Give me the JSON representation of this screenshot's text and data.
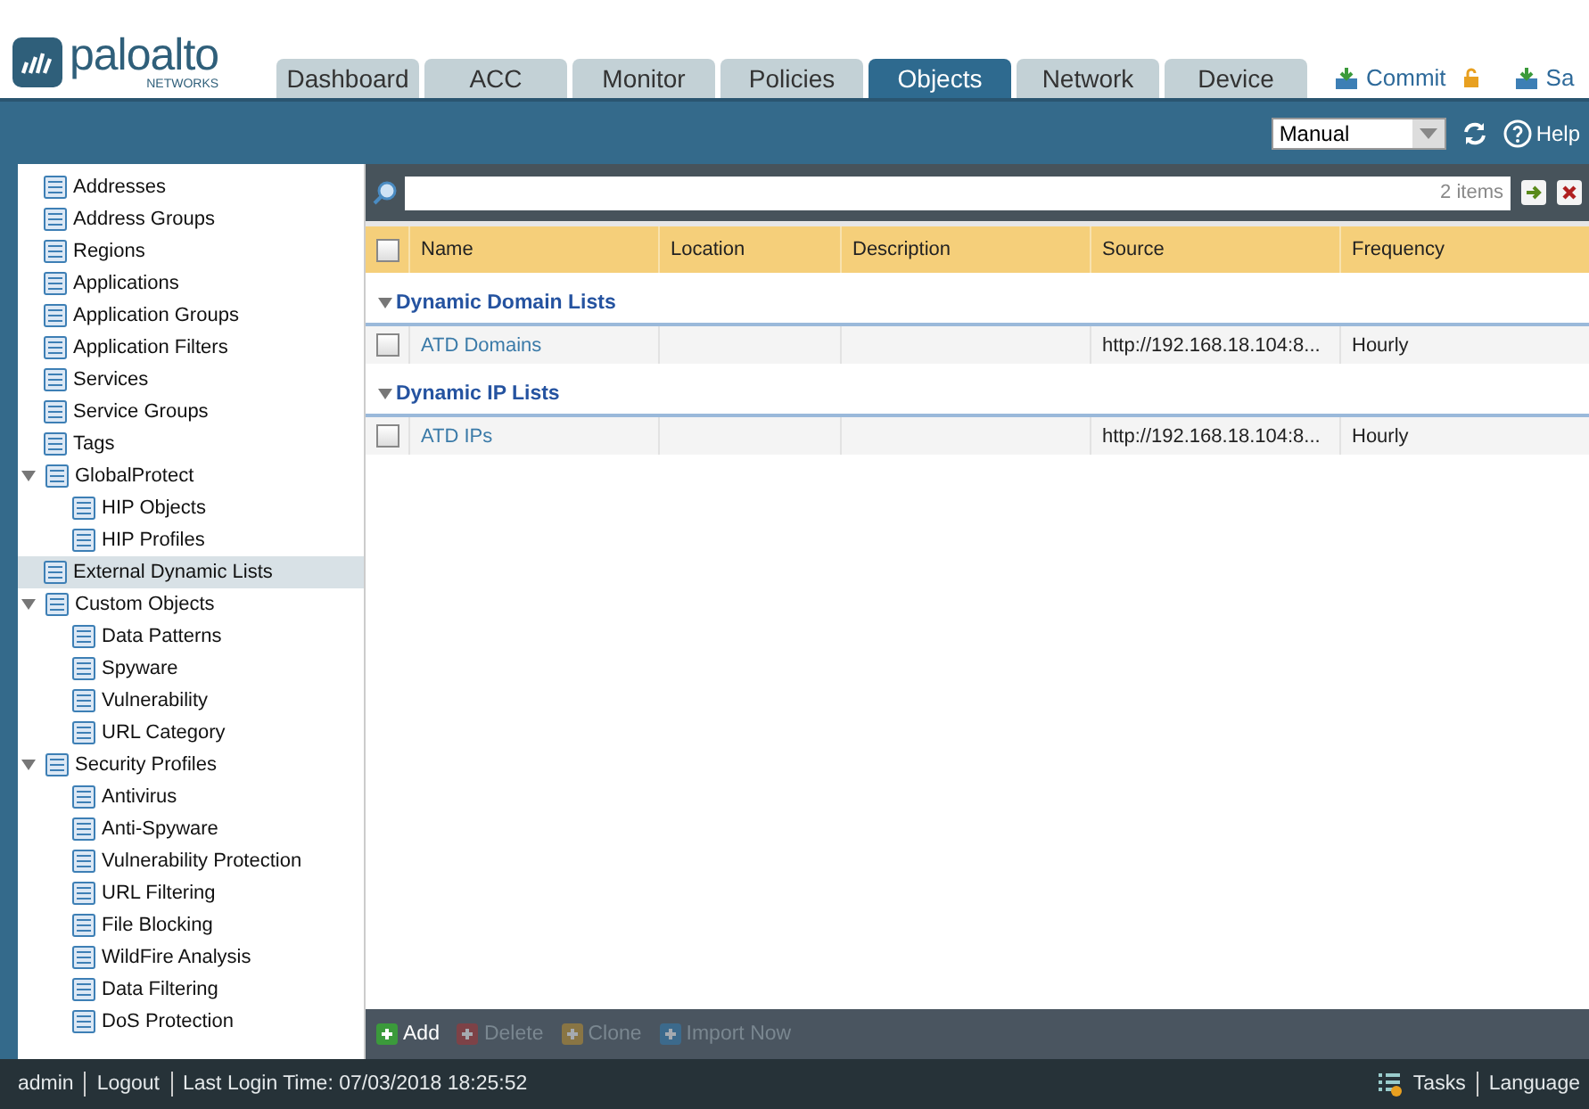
{
  "logo": {
    "name": "paloalto",
    "sub": "NETWORKS"
  },
  "tabs": [
    {
      "label": "Dashboard",
      "selected": false
    },
    {
      "label": "ACC",
      "selected": false
    },
    {
      "label": "Monitor",
      "selected": false
    },
    {
      "label": "Policies",
      "selected": false
    },
    {
      "label": "Objects",
      "selected": true
    },
    {
      "label": "Network",
      "selected": false
    },
    {
      "label": "Device",
      "selected": false
    }
  ],
  "header_actions": [
    {
      "label": "Commit"
    },
    {
      "label": "Sa"
    }
  ],
  "toolbar": {
    "mode": "Manual",
    "help": "Help"
  },
  "sidebar": {
    "items": [
      {
        "label": "Addresses",
        "selected": false
      },
      {
        "label": "Address Groups",
        "selected": false
      },
      {
        "label": "Regions",
        "selected": false
      },
      {
        "label": "Applications",
        "selected": false
      },
      {
        "label": "Application Groups",
        "selected": false
      },
      {
        "label": "Application Filters",
        "selected": false
      },
      {
        "label": "Services",
        "selected": false
      },
      {
        "label": "Service Groups",
        "selected": false
      },
      {
        "label": "Tags",
        "selected": false
      },
      {
        "label": "GlobalProtect",
        "selected": false,
        "expanded": true,
        "children": [
          {
            "label": "HIP Objects",
            "selected": false
          },
          {
            "label": "HIP Profiles",
            "selected": false
          }
        ]
      },
      {
        "label": "External Dynamic Lists",
        "selected": true
      },
      {
        "label": "Custom Objects",
        "selected": false,
        "expanded": true,
        "children": [
          {
            "label": "Data Patterns",
            "selected": false
          },
          {
            "label": "Spyware",
            "selected": false
          },
          {
            "label": "Vulnerability",
            "selected": false
          },
          {
            "label": "URL Category",
            "selected": false
          }
        ]
      },
      {
        "label": "Security Profiles",
        "selected": false,
        "expanded": true,
        "children": [
          {
            "label": "Antivirus",
            "selected": false
          },
          {
            "label": "Anti-Spyware",
            "selected": false
          },
          {
            "label": "Vulnerability Protection",
            "selected": false
          },
          {
            "label": "URL Filtering",
            "selected": false
          },
          {
            "label": "File Blocking",
            "selected": false
          },
          {
            "label": "WildFire Analysis",
            "selected": false
          },
          {
            "label": "Data Filtering",
            "selected": false
          },
          {
            "label": "DoS Protection",
            "selected": false
          }
        ]
      }
    ]
  },
  "search": {
    "count": "2 items"
  },
  "table": {
    "select_all": {
      "checked": false
    },
    "columns": [
      "Name",
      "Location",
      "Description",
      "Source",
      "Frequency"
    ],
    "groups": [
      {
        "title": "Dynamic Domain Lists",
        "expanded": true,
        "rows": [
          {
            "checked": false,
            "cells": [
              "ATD Domains",
              "",
              "",
              "http://192.168.18.104:8...",
              "Hourly"
            ]
          }
        ]
      },
      {
        "title": "Dynamic IP Lists",
        "expanded": true,
        "rows": [
          {
            "checked": false,
            "cells": [
              "ATD IPs",
              "",
              "",
              "http://192.168.18.104:8...",
              "Hourly"
            ]
          }
        ]
      }
    ]
  },
  "actions": [
    {
      "label": "Add",
      "kind": "add",
      "disabled": false
    },
    {
      "label": "Delete",
      "kind": "delete",
      "disabled": true
    },
    {
      "label": "Clone",
      "kind": "clone",
      "disabled": true
    },
    {
      "label": "Import Now",
      "kind": "import",
      "disabled": true
    }
  ],
  "status_bar": {
    "user": "admin",
    "logout": "Logout",
    "last_login": "Last Login Time: 07/03/2018 18:25:52",
    "tasks": "Tasks",
    "language": "Language"
  }
}
